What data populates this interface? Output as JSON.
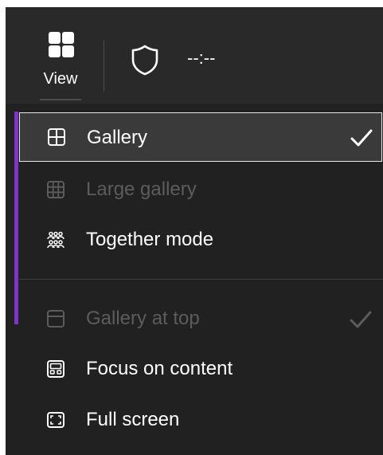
{
  "toolbar": {
    "view_label": "View",
    "timer": "--:--"
  },
  "menu": {
    "items": [
      {
        "label": "Gallery",
        "icon": "grid-2x2-icon",
        "state": "selected",
        "checked": true
      },
      {
        "label": "Large gallery",
        "icon": "grid-3x3-icon",
        "state": "disabled",
        "checked": false
      },
      {
        "label": "Together mode",
        "icon": "people-group-icon",
        "state": "enabled",
        "checked": false
      },
      {
        "label": "Gallery at top",
        "icon": "gallery-top-icon",
        "state": "disabled",
        "checked": true
      },
      {
        "label": "Focus on content",
        "icon": "focus-content-icon",
        "state": "enabled",
        "checked": false
      },
      {
        "label": "Full screen",
        "icon": "full-screen-icon",
        "state": "enabled",
        "checked": false
      }
    ]
  },
  "colors": {
    "toolbar_bg": "#292929",
    "menu_bg": "#212121",
    "selected_bg": "#3a3a3a",
    "accent": "#7f33c8",
    "text": "#ffffff",
    "disabled_text": "#5c5c5c"
  }
}
